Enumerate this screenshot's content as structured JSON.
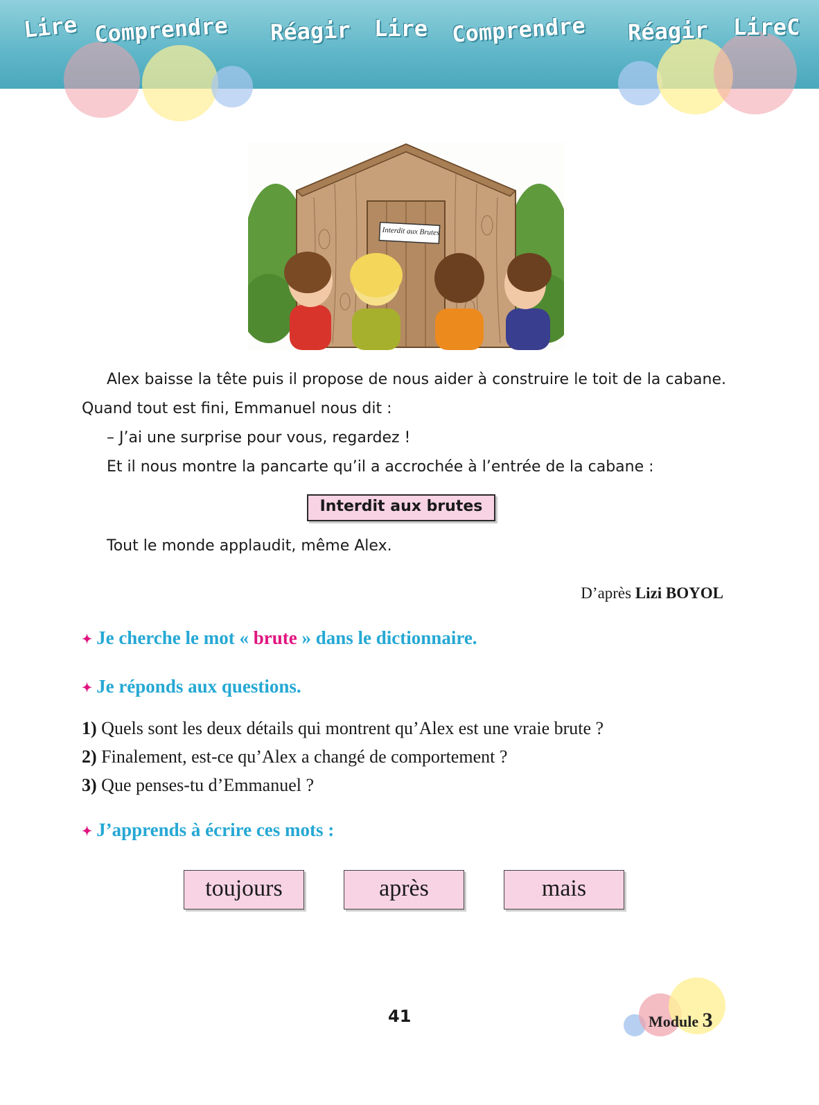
{
  "banner": {
    "words": [
      "Lire",
      "Comprendre",
      "Réagir",
      "Lire",
      "Comprendre",
      "Réagir",
      "LireC"
    ]
  },
  "illustration": {
    "sign_text": "Interdit aux Brutes"
  },
  "story": {
    "paragraph1": "Alex baisse la tête puis il propose de nous aider à construire le toit de la cabane. Quand tout est fini, Emmanuel nous dit :",
    "dialogue": "– J’ai une surprise pour vous, regardez !",
    "paragraph2": "Et il nous montre la pancarte qu’il a accrochée à l’entrée de la cabane :",
    "sign": "Interdit aux brutes",
    "paragraph3": "Tout le monde applaudit, même Alex."
  },
  "credit": {
    "prefix": "D’après",
    "author": "Lizi BOYOL"
  },
  "instructions": {
    "dictionary_a": "Je cherche le mot « ",
    "dictionary_word": "brute",
    "dictionary_b": " » dans le dictionnaire.",
    "questions_title": "Je réponds aux questions.",
    "write_title": "J’apprends à écrire ces mots :"
  },
  "questions": [
    {
      "num": "1)",
      "text": "Quels sont les deux détails qui montrent qu’Alex est une vraie brute ?"
    },
    {
      "num": "2)",
      "text": "Finalement, est-ce qu’Alex a changé de comportement ?"
    },
    {
      "num": "3)",
      "text": "Que penses-tu d’Emmanuel ?"
    }
  ],
  "words": [
    "toujours",
    "après",
    "mais"
  ],
  "footer": {
    "page_number": "41",
    "module_label": "Module",
    "module_number": "3"
  },
  "colors": {
    "banner": "#5fb6c8",
    "instruction_blue": "#25a8d4",
    "instruction_pink": "#e0147f",
    "box_pink": "#f7d3e4"
  }
}
